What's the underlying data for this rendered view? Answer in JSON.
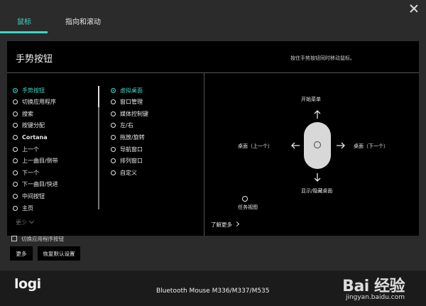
{
  "tabs": [
    {
      "label": "鼠标",
      "active": true
    },
    {
      "label": "指向和滚动",
      "active": false
    }
  ],
  "panel": {
    "title": "手势按钮",
    "hint": "按住手势按钮同时移动鼠标。"
  },
  "left_list": [
    {
      "label": "手势按钮",
      "selected": true
    },
    {
      "label": "切换应用程序",
      "selected": false
    },
    {
      "label": "搜索",
      "selected": false
    },
    {
      "label": "按键分配",
      "selected": false
    },
    {
      "label": "Cortana",
      "selected": false,
      "bold": true
    },
    {
      "label": "上一个",
      "selected": false
    },
    {
      "label": "上一曲目/倒带",
      "selected": false
    },
    {
      "label": "下一个",
      "selected": false
    },
    {
      "label": "下一曲目/快进",
      "selected": false
    },
    {
      "label": "中间按钮",
      "selected": false
    },
    {
      "label": "主页",
      "selected": false
    }
  ],
  "right_list": [
    {
      "label": "虚拟桌面",
      "selected": true
    },
    {
      "label": "窗口管理",
      "selected": false
    },
    {
      "label": "媒体控制键",
      "selected": false
    },
    {
      "label": "左/右",
      "selected": false
    },
    {
      "label": "拖放/旋转",
      "selected": false
    },
    {
      "label": "导航窗口",
      "selected": false
    },
    {
      "label": "排列窗口",
      "selected": false
    },
    {
      "label": "自定义",
      "selected": false
    }
  ],
  "more_label": "更少",
  "gesture": {
    "up": "开始菜单",
    "left": "桌面（上一个）",
    "right": "桌面（下一个）",
    "down": "显示/隐藏桌面",
    "task_view": "任务视图",
    "learn_more": "了解更多"
  },
  "footer": {
    "checkbox_label": "切换应用程序按钮",
    "more_button": "更多",
    "restore_button": "恢复默认设置"
  },
  "bottom": {
    "logo": "logi",
    "device": "Bluetooth Mouse M336/M337/M535",
    "watermark_brand": "Bai  经验",
    "watermark_url": "jingyan.baidu.com"
  },
  "colors": {
    "accent": "#3fd3c5",
    "panel_bg": "#000000",
    "window_bg": "#2b2b2b"
  }
}
